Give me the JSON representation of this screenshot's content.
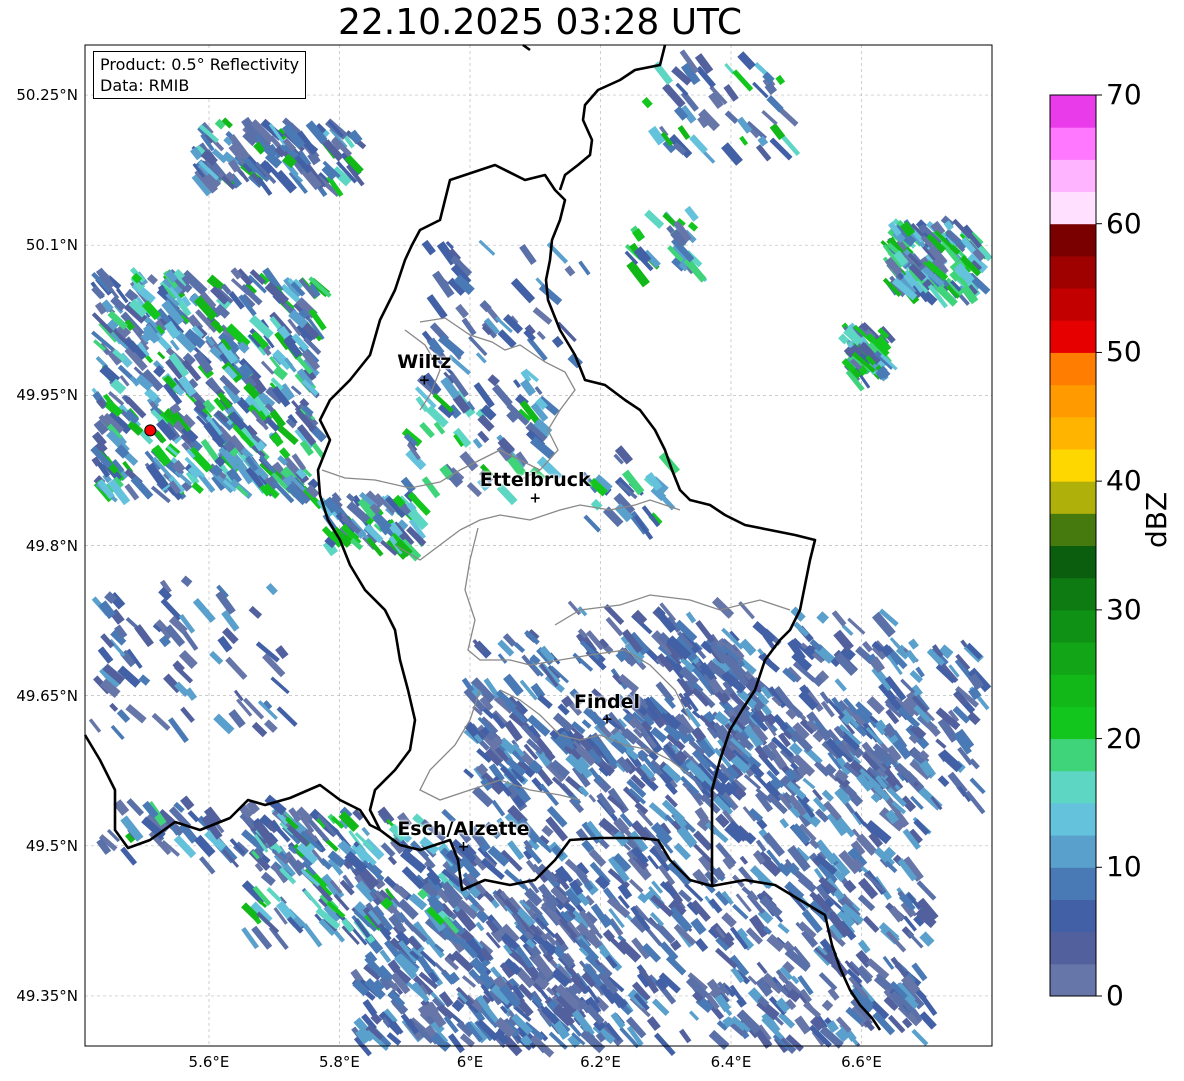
{
  "title": "22.10.2025 03:28 UTC",
  "info": {
    "product": "Product: 0.5° Reflectivity",
    "data": "Data: RMIB"
  },
  "map": {
    "lon_range": [
      5.41,
      6.8
    ],
    "lat_range": [
      49.3,
      50.3
    ],
    "lat_ticks": [
      {
        "value": 50.25,
        "label": "50.25°N"
      },
      {
        "value": 50.1,
        "label": "50.1°N"
      },
      {
        "value": 49.95,
        "label": "49.95°N"
      },
      {
        "value": 49.8,
        "label": "49.8°N"
      },
      {
        "value": 49.65,
        "label": "49.65°N"
      },
      {
        "value": 49.5,
        "label": "49.5°N"
      },
      {
        "value": 49.35,
        "label": "49.35°N"
      }
    ],
    "lon_ticks": [
      {
        "value": 5.6,
        "label": "5.6°E"
      },
      {
        "value": 5.8,
        "label": "5.8°E"
      },
      {
        "value": 6.0,
        "label": "6°E"
      },
      {
        "value": 6.2,
        "label": "6.2°E"
      },
      {
        "value": 6.4,
        "label": "6.4°E"
      },
      {
        "value": 6.6,
        "label": "6.6°E"
      }
    ],
    "grid": true,
    "radar_site": {
      "lon": 5.51,
      "lat": 49.915
    },
    "cities": [
      {
        "name": "Wiltz",
        "lon": 5.93,
        "lat": 49.966
      },
      {
        "name": "Ettelbruck",
        "lon": 6.1,
        "lat": 49.848
      },
      {
        "name": "Findel",
        "lon": 6.21,
        "lat": 49.627
      },
      {
        "name": "Esch/Alzette",
        "lon": 5.99,
        "lat": 49.5
      }
    ]
  },
  "colorbar": {
    "label": "dBZ",
    "min": 0,
    "max": 70,
    "ticks": [
      "0",
      "10",
      "20",
      "30",
      "40",
      "50",
      "60",
      "70"
    ],
    "colors": [
      "#6776a8",
      "#52619d",
      "#4260a5",
      "#4a7ab5",
      "#5aa0cc",
      "#64c2dc",
      "#5dd6c4",
      "#3fd47a",
      "#13c61e",
      "#12b818",
      "#11a517",
      "#0f9116",
      "#0d7a12",
      "#0a5e0e",
      "#477a0e",
      "#b0b00a",
      "#ffd700",
      "#ffb400",
      "#ff9a00",
      "#ff7d00",
      "#e60000",
      "#c30000",
      "#9f0000",
      "#7a0000",
      "#ffe0ff",
      "#ffb4ff",
      "#ff78ff",
      "#ea3bea"
    ]
  },
  "colors": {
    "country_border": "#000000",
    "canton_border": "#888888",
    "grid": "#bbbbbb",
    "radar_marker": "#ff0000"
  }
}
